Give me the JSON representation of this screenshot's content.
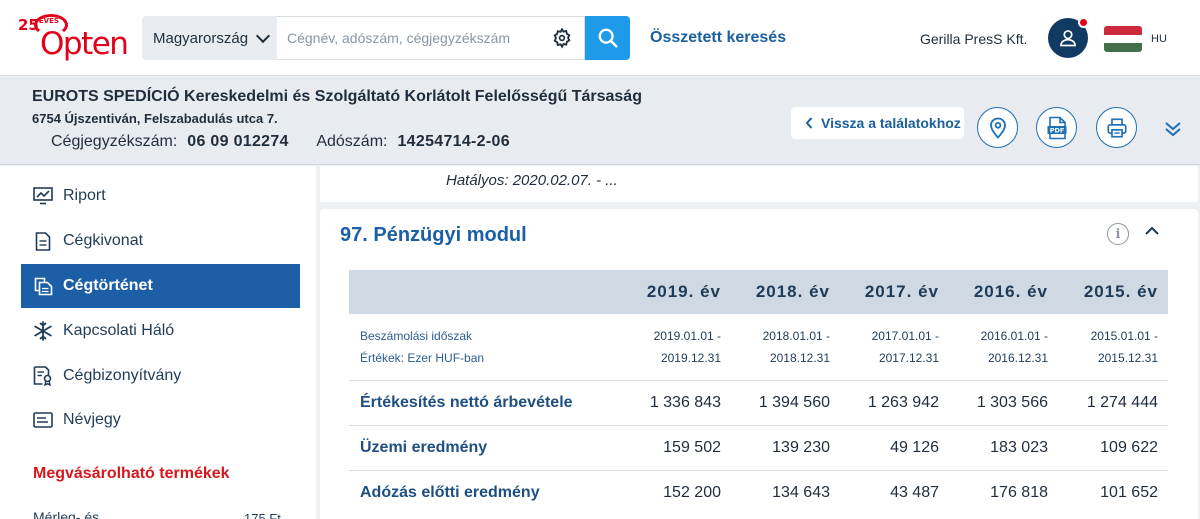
{
  "logo": {
    "years_badge": "25",
    "years_sub": "ÉVES",
    "brand": "Opten"
  },
  "search": {
    "country": "Magyarország",
    "placeholder": "Cégnév, adószám, cégjegyzékszám"
  },
  "nav": {
    "advanced_search": "Összetett keresés",
    "user_company": "Gerilla PresS Kft.",
    "language": "HU"
  },
  "colors": {
    "brand_red": "#e2001a",
    "primary_blue": "#1c5fa6",
    "accent_blue": "#1e9be8",
    "flag": [
      "#cd2a3e",
      "#ffffff",
      "#436f4d"
    ]
  },
  "company": {
    "name": "EUROTS SPEDÍCIÓ Kereskedelmi és Szolgáltató Korlátolt Felelősségű Társaság",
    "address": "6754 Újszentiván, Felszabadulás utca 7.",
    "reg_label": "Cégjegyzékszám:",
    "reg_number": "06 09 012274",
    "tax_label": "Adószám:",
    "tax_number": "14254714-2-06",
    "back_button": "Vissza a találatokhoz"
  },
  "header_icons": [
    "map-pin-icon",
    "pdf-icon",
    "print-icon",
    "double-chevron-down-icon"
  ],
  "sidebar": {
    "items": [
      {
        "label": "Riport",
        "icon": "monitor-chart-icon"
      },
      {
        "label": "Cégkivonat",
        "icon": "document-icon"
      },
      {
        "label": "Cégtörténet",
        "icon": "documents-copy-icon",
        "active": true
      },
      {
        "label": "Kapcsolati Háló",
        "icon": "snowflake-network-icon"
      },
      {
        "label": "Cégbizonyítvány",
        "icon": "certificate-icon"
      },
      {
        "label": "Névjegy",
        "icon": "card-icon"
      }
    ],
    "buy_title": "Megvásárolható termékek",
    "partial_item": "Mérleg- és",
    "partial_price": "175 Ft"
  },
  "content": {
    "validity": "Hatályos: 2020.02.07. - ...",
    "panel_title": "97. Pénzügyi modul",
    "table": {
      "years": [
        "2019. év",
        "2018. év",
        "2017. év",
        "2016. év",
        "2015. év"
      ],
      "period_label": "Beszámolási időszak",
      "unit_label": "Értékek: Ezer HUF-ban",
      "periods": [
        [
          "2019.01.01 -",
          "2019.12.31"
        ],
        [
          "2018.01.01 -",
          "2018.12.31"
        ],
        [
          "2017.01.01 -",
          "2017.12.31"
        ],
        [
          "2016.01.01 -",
          "2016.12.31"
        ],
        [
          "2015.01.01 -",
          "2015.12.31"
        ]
      ],
      "rows": [
        {
          "label": "Értékesítés nettó árbevétele",
          "values": [
            "1 336 843",
            "1 394 560",
            "1 263 942",
            "1 303 566",
            "1 274 444"
          ]
        },
        {
          "label": "Üzemi eredmény",
          "values": [
            "159 502",
            "139 230",
            "49 126",
            "183 023",
            "109 622"
          ]
        },
        {
          "label": "Adózás előtti eredmény",
          "values": [
            "152 200",
            "134 643",
            "43 487",
            "176 818",
            "101 652"
          ]
        }
      ]
    }
  }
}
